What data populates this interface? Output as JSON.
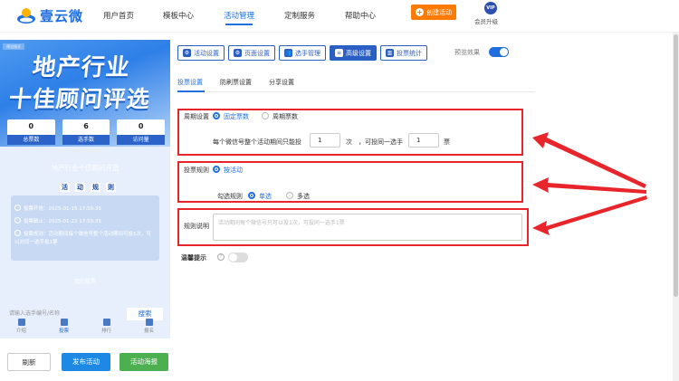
{
  "nav": {
    "brand": "壹云微",
    "items": [
      "用户首页",
      "模板中心",
      "活动管理",
      "定制服务",
      "帮助中心"
    ],
    "active_index": 2,
    "create_button": "创建活动",
    "vip_badge": "VIP",
    "vip_label": "会员升级"
  },
  "preview": {
    "corner_tag": "预览模式",
    "banner_line1": "地产行业",
    "banner_line2": "十佳顾问评选",
    "stats": [
      {
        "value": "0",
        "label": "总票数"
      },
      {
        "value": "6",
        "label": "选手数"
      },
      {
        "value": "0",
        "label": "访问量"
      }
    ],
    "activity_title": "地产行业十佳顾问评选",
    "rules_title": [
      "活",
      "动",
      "规",
      "则"
    ],
    "rule_lines": [
      "投票开始：2025-01-15 17:50:35",
      "投票截止：2025-01-22 17:50:35",
      "投票规则：活动期间每个微信号整个活动期间可投1次，可以对同一选手投1票"
    ],
    "footer_text": "我的投票",
    "search_placeholder": "请输入选手编号/名称",
    "search_button": "搜索",
    "tabs": [
      "介绍",
      "投票",
      "排行",
      "报名"
    ],
    "active_tab": 1
  },
  "bottom_buttons": {
    "refresh": "刷新",
    "publish": "发布活动",
    "poster": "活动海报"
  },
  "toolbar": {
    "buttons": [
      "活动设置",
      "页面设置",
      "选手管理",
      "高级设置",
      "投票统计"
    ],
    "active_index": 3,
    "preview_label": "预览效果",
    "preview_on": true
  },
  "subtabs": {
    "items": [
      "投票设置",
      "防刷票设置",
      "分享设置"
    ],
    "active_index": 0
  },
  "cycle": {
    "label": "周期设置",
    "options": [
      "固定票数",
      "周期票数"
    ],
    "selected": 0,
    "text_before": "每个微信号整个活动期间只能投",
    "votes_value": "1",
    "unit_times": "次",
    "text_middle": "，可投同一选手",
    "per_player_value": "1",
    "unit_votes": "票"
  },
  "rule": {
    "label": "投票规则",
    "option": "按活动",
    "check_label": "勾选规则",
    "check_options": [
      "单选",
      "多选"
    ],
    "check_selected": 0
  },
  "rule_desc": {
    "label": "规则说明",
    "placeholder": "活动期间每个微信号只可以投1次，可投同一选手1票"
  },
  "tip": {
    "label": "温馨提示",
    "enabled": false
  },
  "colors": {
    "primary": "#1f6fe0",
    "accent": "#ff7a00",
    "publish": "#1e88e5",
    "poster": "#4caf50",
    "highlight": "#e8252b"
  }
}
